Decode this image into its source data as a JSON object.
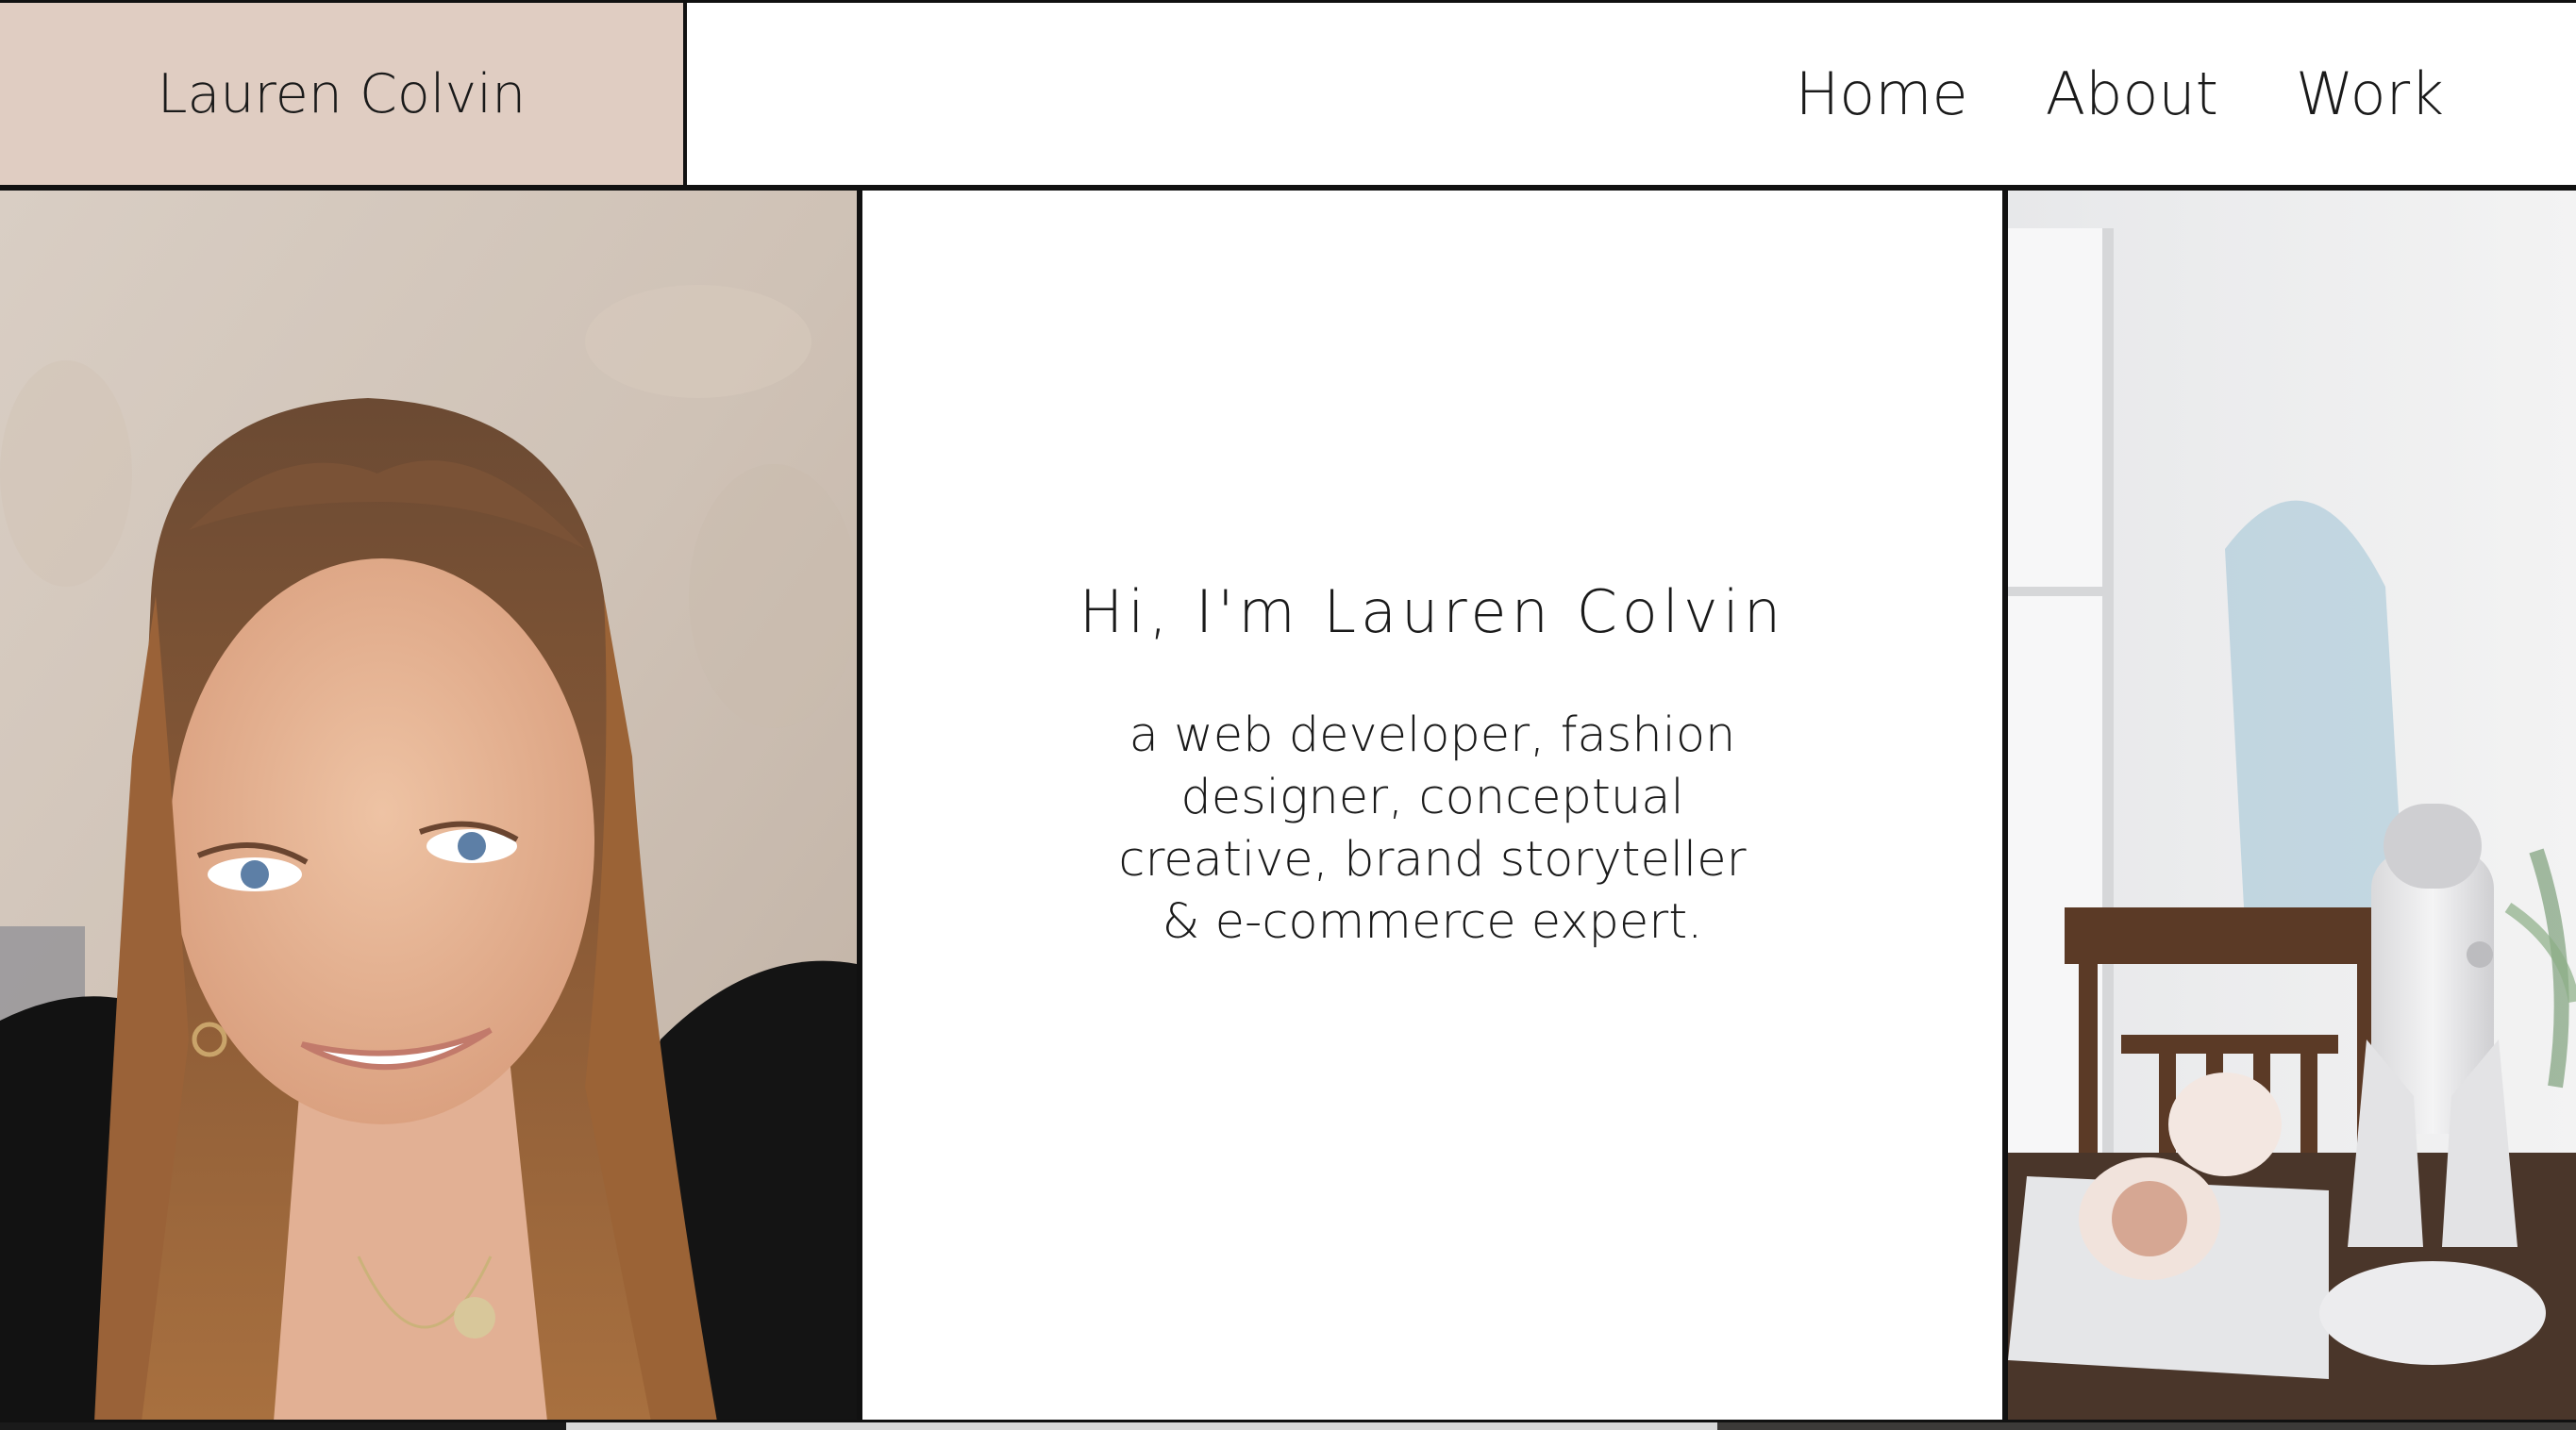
{
  "header": {
    "brand": "Lauren Colvin",
    "nav": [
      {
        "label": "Home"
      },
      {
        "label": "About"
      },
      {
        "label": "Work"
      }
    ]
  },
  "hero": {
    "title": "Hi, I'm Lauren Colvin",
    "subtitle": "a web developer, fashion designer, conceptual creative, brand storyteller & e-commerce expert."
  },
  "colors": {
    "brand_box": "#e0cdc2",
    "border": "#111111",
    "background": "#ffffff"
  },
  "images": {
    "left": "portrait-photo",
    "right": "studio-microphone-photo"
  }
}
